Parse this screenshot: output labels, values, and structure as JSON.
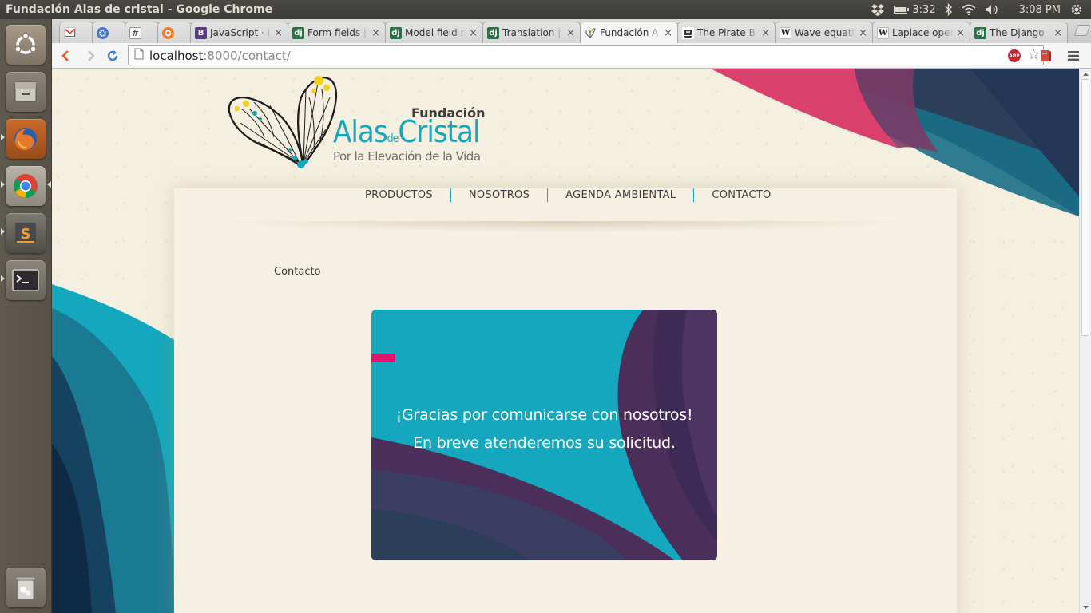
{
  "system": {
    "window_title": "Fundación Alas de cristal - Google Chrome",
    "battery": "3:32",
    "clock": "3:08 PM"
  },
  "launcher": {
    "items": [
      "ubuntu-dash",
      "files",
      "firefox",
      "chrome",
      "sublime-text",
      "terminal",
      "trash"
    ]
  },
  "browser": {
    "tabs": [
      {
        "title": "",
        "favicon": "gmail-icon",
        "active": false
      },
      {
        "title": "",
        "favicon": "settings-icon",
        "active": false
      },
      {
        "title": "",
        "favicon": "hash-icon",
        "active": false
      },
      {
        "title": "",
        "favicon": "orange-icon",
        "active": false
      },
      {
        "title": "JavaScript · I",
        "favicon": "bootstrap-icon",
        "active": false
      },
      {
        "title": "Form fields |",
        "favicon": "django-icon",
        "active": false
      },
      {
        "title": "Model field r",
        "favicon": "django-icon",
        "active": false
      },
      {
        "title": "Translation |",
        "favicon": "django-icon",
        "active": false
      },
      {
        "title": "Fundación A",
        "favicon": "butterfly-icon",
        "active": true
      },
      {
        "title": "The Pirate B",
        "favicon": "pirate-icon",
        "active": false
      },
      {
        "title": "Wave equati",
        "favicon": "wikipedia-icon",
        "active": false
      },
      {
        "title": "Laplace oper",
        "favicon": "wikipedia-icon",
        "active": false
      },
      {
        "title": "The Django",
        "favicon": "django-icon",
        "active": false
      }
    ],
    "close_glyph": "×",
    "url_host": "localhost",
    "url_rest": ":8000/contact/",
    "abp_label": "ABP"
  },
  "page": {
    "logo": {
      "line1": "Fundación",
      "line2_a": "Alas",
      "line2_b": "de",
      "line2_c": "Cristal",
      "line3": "Por la Elevación de la Vida"
    },
    "nav": [
      "PRODUCTOS",
      "NOSOTROS",
      "AGENDA AMBIENTAL",
      "CONTACTO"
    ],
    "breadcrumb": "Contacto",
    "thanks": {
      "line1": "¡Gracias por comunicarse con nosotros!",
      "line2": "En breve atenderemos su solicitud."
    },
    "colors": {
      "teal": "#14a7bd",
      "pink": "#e2136e",
      "purple": "#4b2e5a",
      "navy": "#2c3e5a"
    }
  }
}
